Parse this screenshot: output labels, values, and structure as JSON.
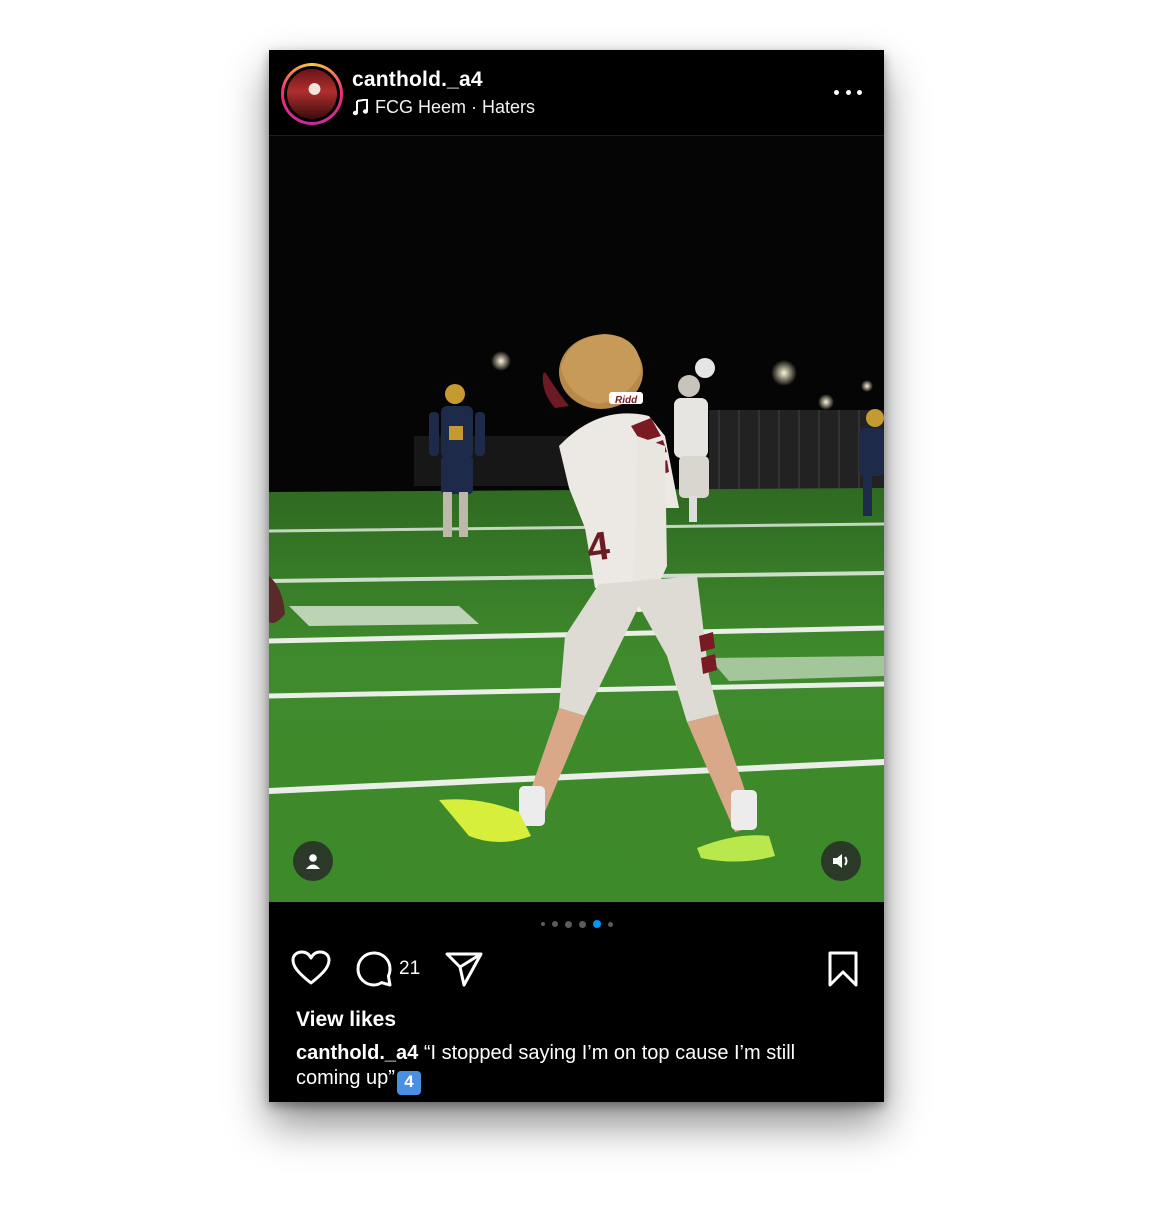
{
  "post": {
    "username": "canthold._a4",
    "audio": "FCG Heem · Haters",
    "comments_count": "21",
    "view_likes_label": "View likes",
    "caption_username": "canthold._a4",
    "caption_text": "“I stopped saying I’m on top cause I’m still coming up”",
    "caption_emoji": "4",
    "carousel": {
      "total": 6,
      "active_index": 4
    },
    "photo_text": {
      "jersey_number": "4",
      "helmet_brand": "Ridd"
    }
  },
  "icons": {
    "more": "more-options-icon",
    "music": "music-note-icon",
    "like": "heart-icon",
    "comment": "comment-bubble-icon",
    "share": "paper-plane-icon",
    "save": "bookmark-icon",
    "tag": "person-tag-icon",
    "sound": "speaker-icon"
  },
  "colors": {
    "active_dot": "#0095f6",
    "inactive_dot": "#5b5b5b",
    "field_green": "#3f8a2c",
    "background": "#000000"
  }
}
